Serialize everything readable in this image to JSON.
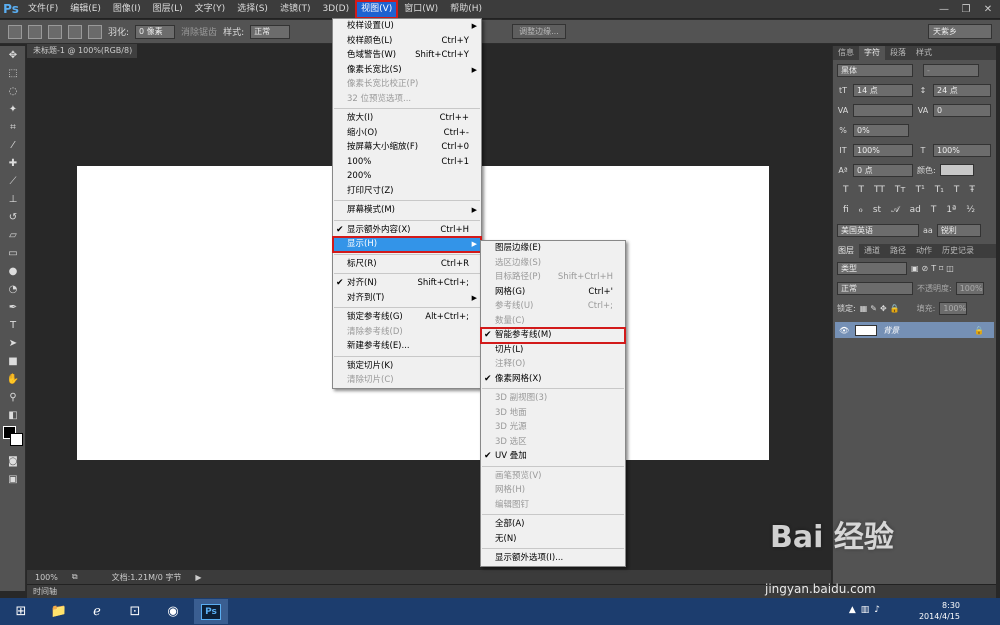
{
  "app": {
    "logo": "Ps"
  },
  "menubar": {
    "items": [
      "文件(F)",
      "编辑(E)",
      "图像(I)",
      "图层(L)",
      "文字(Y)",
      "选择(S)",
      "滤镜(T)",
      "3D(D)",
      "视图(V)",
      "窗口(W)",
      "帮助(H)"
    ],
    "active_index": 8
  },
  "window_controls": {
    "minimize": "—",
    "restore": "❐",
    "close": "✕"
  },
  "options_bar": {
    "feather_label": "羽化:",
    "feather_value": "0 像素",
    "antialias_label": "消除锯齿",
    "style_label": "样式:",
    "style_value": "正常",
    "refine_edge": "调整边缘...",
    "workspace": "天紫乡"
  },
  "document": {
    "tab_title": "未标题-1 @ 100%(RGB/8)"
  },
  "status_bar": {
    "zoom": "100%",
    "doc_info": "文档:1.21M/0 字节"
  },
  "timeline": {
    "label": "时间轴"
  },
  "char_panel": {
    "tabs": [
      "信息",
      "字符",
      "段落",
      "样式"
    ],
    "active_tab": 1,
    "font_family": "黑体",
    "font_style": "-",
    "font_size": "14 点",
    "leading": "24 点",
    "kerning": "",
    "tracking": "0",
    "scale_pct": "0%",
    "vscale": "100%",
    "hscale": "100%",
    "baseline": "0 点",
    "color_label": "颜色:",
    "language": "美国英语",
    "aa_label": "aa",
    "aa_value": "锐利"
  },
  "layers_panel": {
    "tabs": [
      "图层",
      "通道",
      "路径",
      "动作",
      "历史记录"
    ],
    "kind_label": "类型",
    "blend_mode": "正常",
    "opacity_label": "不透明度:",
    "opacity_value": "100%",
    "lock_label": "锁定:",
    "fill_label": "填充:",
    "fill_value": "100%",
    "layer_name": "背景"
  },
  "view_menu": {
    "items": [
      {
        "label": "校样设置(U)",
        "shortcut": "",
        "submenu": true
      },
      {
        "label": "校样颜色(L)",
        "shortcut": "Ctrl+Y"
      },
      {
        "label": "色域警告(W)",
        "shortcut": "Shift+Ctrl+Y"
      },
      {
        "label": "像素长宽比(S)",
        "shortcut": "",
        "submenu": true
      },
      {
        "label": "像素长宽比校正(P)",
        "shortcut": "",
        "disabled": true
      },
      {
        "label": "32 位预览选项...",
        "shortcut": "",
        "disabled": true
      },
      {
        "sep": true
      },
      {
        "label": "放大(I)",
        "shortcut": "Ctrl++"
      },
      {
        "label": "缩小(O)",
        "shortcut": "Ctrl+-"
      },
      {
        "label": "按屏幕大小缩放(F)",
        "shortcut": "Ctrl+0"
      },
      {
        "label": "100%",
        "shortcut": "Ctrl+1"
      },
      {
        "label": "200%",
        "shortcut": ""
      },
      {
        "label": "打印尺寸(Z)",
        "shortcut": ""
      },
      {
        "sep": true
      },
      {
        "label": "屏幕模式(M)",
        "shortcut": "",
        "submenu": true
      },
      {
        "sep": true
      },
      {
        "label": "显示额外内容(X)",
        "shortcut": "Ctrl+H",
        "checked": true
      },
      {
        "label": "显示(H)",
        "shortcut": "",
        "submenu": true,
        "highlight": true
      },
      {
        "sep": true
      },
      {
        "label": "标尺(R)",
        "shortcut": "Ctrl+R"
      },
      {
        "sep": true
      },
      {
        "label": "对齐(N)",
        "shortcut": "Shift+Ctrl+;",
        "checked": true
      },
      {
        "label": "对齐到(T)",
        "shortcut": "",
        "submenu": true
      },
      {
        "sep": true
      },
      {
        "label": "锁定参考线(G)",
        "shortcut": "Alt+Ctrl+;"
      },
      {
        "label": "清除参考线(D)",
        "shortcut": "",
        "disabled": true
      },
      {
        "label": "新建参考线(E)...",
        "shortcut": ""
      },
      {
        "sep": true
      },
      {
        "label": "锁定切片(K)",
        "shortcut": ""
      },
      {
        "label": "清除切片(C)",
        "shortcut": "",
        "disabled": true
      }
    ]
  },
  "show_submenu": {
    "items": [
      {
        "label": "图层边缘(E)",
        "shortcut": ""
      },
      {
        "label": "选区边缘(S)",
        "shortcut": "",
        "disabled": true
      },
      {
        "label": "目标路径(P)",
        "shortcut": "Shift+Ctrl+H",
        "disabled": true
      },
      {
        "label": "网格(G)",
        "shortcut": "Ctrl+'"
      },
      {
        "label": "参考线(U)",
        "shortcut": "Ctrl+;",
        "disabled": true
      },
      {
        "label": "数量(C)",
        "shortcut": "",
        "disabled": true
      },
      {
        "label": "智能参考线(M)",
        "shortcut": "",
        "checked": true,
        "boxed": true
      },
      {
        "label": "切片(L)",
        "shortcut": ""
      },
      {
        "label": "注释(O)",
        "shortcut": "",
        "disabled": true
      },
      {
        "label": "像素网格(X)",
        "shortcut": "",
        "checked": true
      },
      {
        "sep": true
      },
      {
        "label": "3D 副视图(3)",
        "shortcut": "",
        "disabled": true
      },
      {
        "label": "3D 地面",
        "shortcut": "",
        "disabled": true
      },
      {
        "label": "3D 光源",
        "shortcut": "",
        "disabled": true
      },
      {
        "label": "3D 选区",
        "shortcut": "",
        "disabled": true
      },
      {
        "label": "UV 叠加",
        "shortcut": "",
        "checked": true
      },
      {
        "sep": true
      },
      {
        "label": "画笔预览(V)",
        "shortcut": "",
        "disabled": true
      },
      {
        "label": "网格(H)",
        "shortcut": "",
        "disabled": true
      },
      {
        "label": "编辑图钉",
        "shortcut": "",
        "disabled": true
      },
      {
        "sep": true
      },
      {
        "label": "全部(A)",
        "shortcut": ""
      },
      {
        "label": "无(N)",
        "shortcut": ""
      },
      {
        "sep": true
      },
      {
        "label": "显示额外选项(I)...",
        "shortcut": ""
      }
    ]
  },
  "taskbar": {
    "time": "8:30",
    "date": "2014/4/15",
    "ps_label": "Ps"
  },
  "watermark": {
    "text": "Bai 经验",
    "url": "jingyan.baidu.com"
  }
}
